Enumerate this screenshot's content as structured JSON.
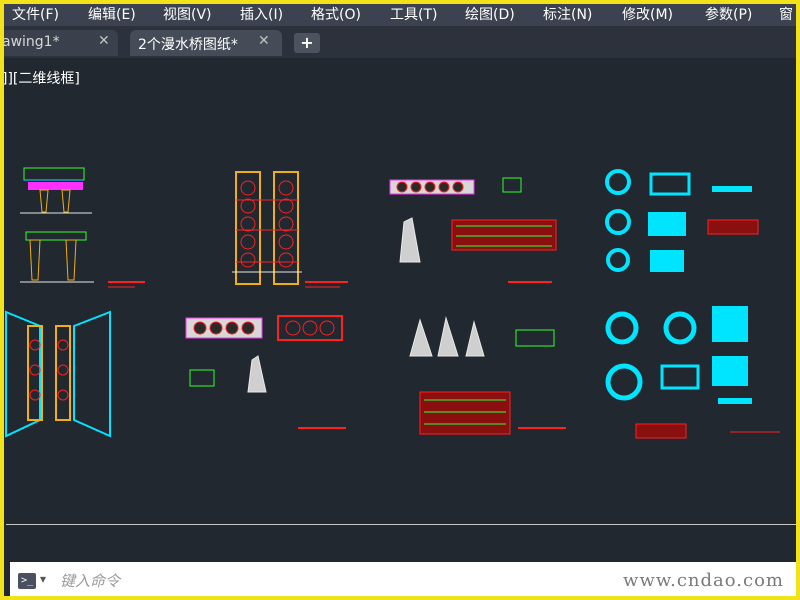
{
  "menubar": {
    "items": [
      "文件(F)",
      "编辑(E)",
      "视图(V)",
      "插入(I)",
      "格式(O)",
      "工具(T)",
      "绘图(D)",
      "标注(N)",
      "修改(M)",
      "参数(P)",
      "窗"
    ]
  },
  "tabs": [
    {
      "label": "awing1*",
      "close": "✕",
      "active": false
    },
    {
      "label": "2个漫水桥图纸*",
      "close": "✕",
      "active": true
    }
  ],
  "tab_add": "+",
  "viewport_label": "]][二维线框]",
  "command": {
    "placeholder": "键入命令",
    "icon": ">_",
    "arrow": "▾"
  },
  "watermark": "www.cndao.com",
  "colors": {
    "background": "#212830",
    "frame": "#f2e21a",
    "cad_yellow": "#f0b010",
    "cad_red": "#ff2020",
    "cad_cyan": "#00e5ff",
    "cad_green": "#30ff30",
    "cad_magenta": "#ff30ff",
    "cad_white": "#e8e8e8"
  }
}
